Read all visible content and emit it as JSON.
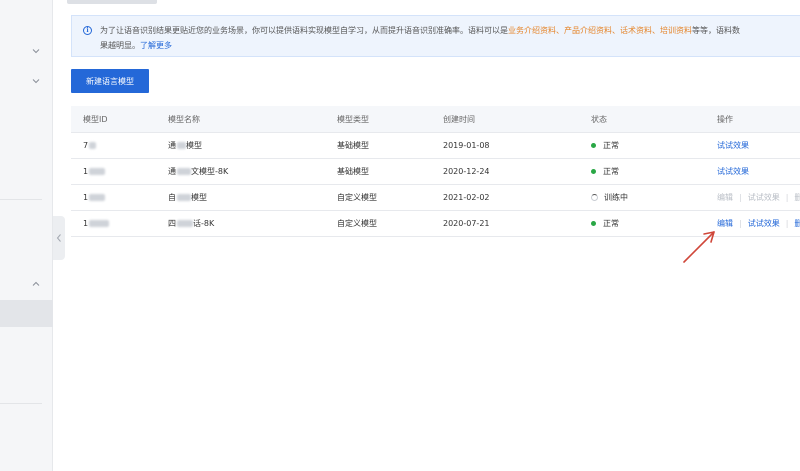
{
  "notice": {
    "line1_prefix": "为了让语音识别结果更贴近您的业务场景，你可以提供语料实现模型自学习，从而提升语音识别准确率。语料可以是",
    "highlights": [
      "业务介绍资料、",
      "产品介绍资料、",
      "话术资料、",
      "培训资料"
    ],
    "line1_suffix": "等等，语料数",
    "line2_text": "果越明显。",
    "line2_link": "了解更多"
  },
  "toolbar": {
    "new_button": "新建语言模型"
  },
  "table": {
    "headers": [
      "模型ID",
      "模型名称",
      "模型类型",
      "创建时间",
      "状态",
      "操作"
    ],
    "rows": [
      {
        "id": "7",
        "name_a": "通",
        "name_b": "模型",
        "type": "基础模型",
        "created": "2019-01-08",
        "status": "正常",
        "status_kind": "ok",
        "ops": [
          "试试效果"
        ]
      },
      {
        "id": "1",
        "name_a": "通",
        "name_b": "文模型-8K",
        "type": "基础模型",
        "created": "2020-12-24",
        "status": "正常",
        "status_kind": "ok",
        "ops": [
          "试试效果"
        ]
      },
      {
        "id": "1",
        "name_a": "自",
        "name_b": "模型",
        "type": "自定义模型",
        "created": "2021-02-02",
        "status": "训练中",
        "status_kind": "training",
        "ops": [
          "编辑",
          "试试效果",
          "删"
        ]
      },
      {
        "id": "1",
        "name_a": "四",
        "name_b": "话-8K",
        "type": "自定义模型",
        "created": "2020-07-21",
        "status": "正常",
        "status_kind": "ok",
        "ops": [
          "编辑",
          "试试效果",
          "删"
        ]
      }
    ]
  },
  "colors": {
    "accent": "#2468d8",
    "highlight": "#e5852a",
    "ok": "#29a745",
    "annotation": "#d0473a"
  }
}
